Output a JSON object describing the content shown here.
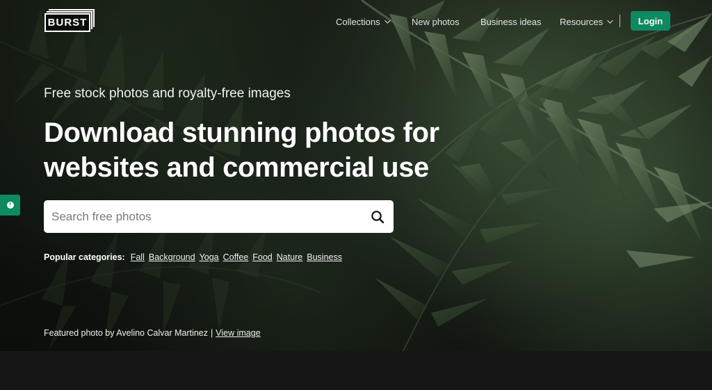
{
  "brand": {
    "logo_text": "BURST"
  },
  "nav": {
    "items": [
      {
        "label": "Collections",
        "has_dropdown": true
      },
      {
        "label": "New photos",
        "has_dropdown": false
      },
      {
        "label": "Business ideas",
        "has_dropdown": false
      },
      {
        "label": "Resources",
        "has_dropdown": true
      }
    ],
    "login_label": "Login"
  },
  "colors": {
    "accent": "#0d8a5f",
    "hero_bg": "#1b2219",
    "bottom_band": "#161616"
  },
  "hero": {
    "subtitle": "Free stock photos and royalty-free images",
    "title": "Download stunning photos for websites and commercial use"
  },
  "search": {
    "placeholder": "Search free photos",
    "value": "",
    "icon": "search-icon"
  },
  "categories": {
    "label": "Popular categories:",
    "items": [
      "Fall",
      "Background",
      "Yoga",
      "Coffee",
      "Food",
      "Nature",
      "Business"
    ]
  },
  "featured": {
    "text": "Featured photo by Avelino Calvar Martinez",
    "separator": "|",
    "link_label": "View image"
  },
  "feedback_tab": {
    "icon": "info-icon"
  }
}
